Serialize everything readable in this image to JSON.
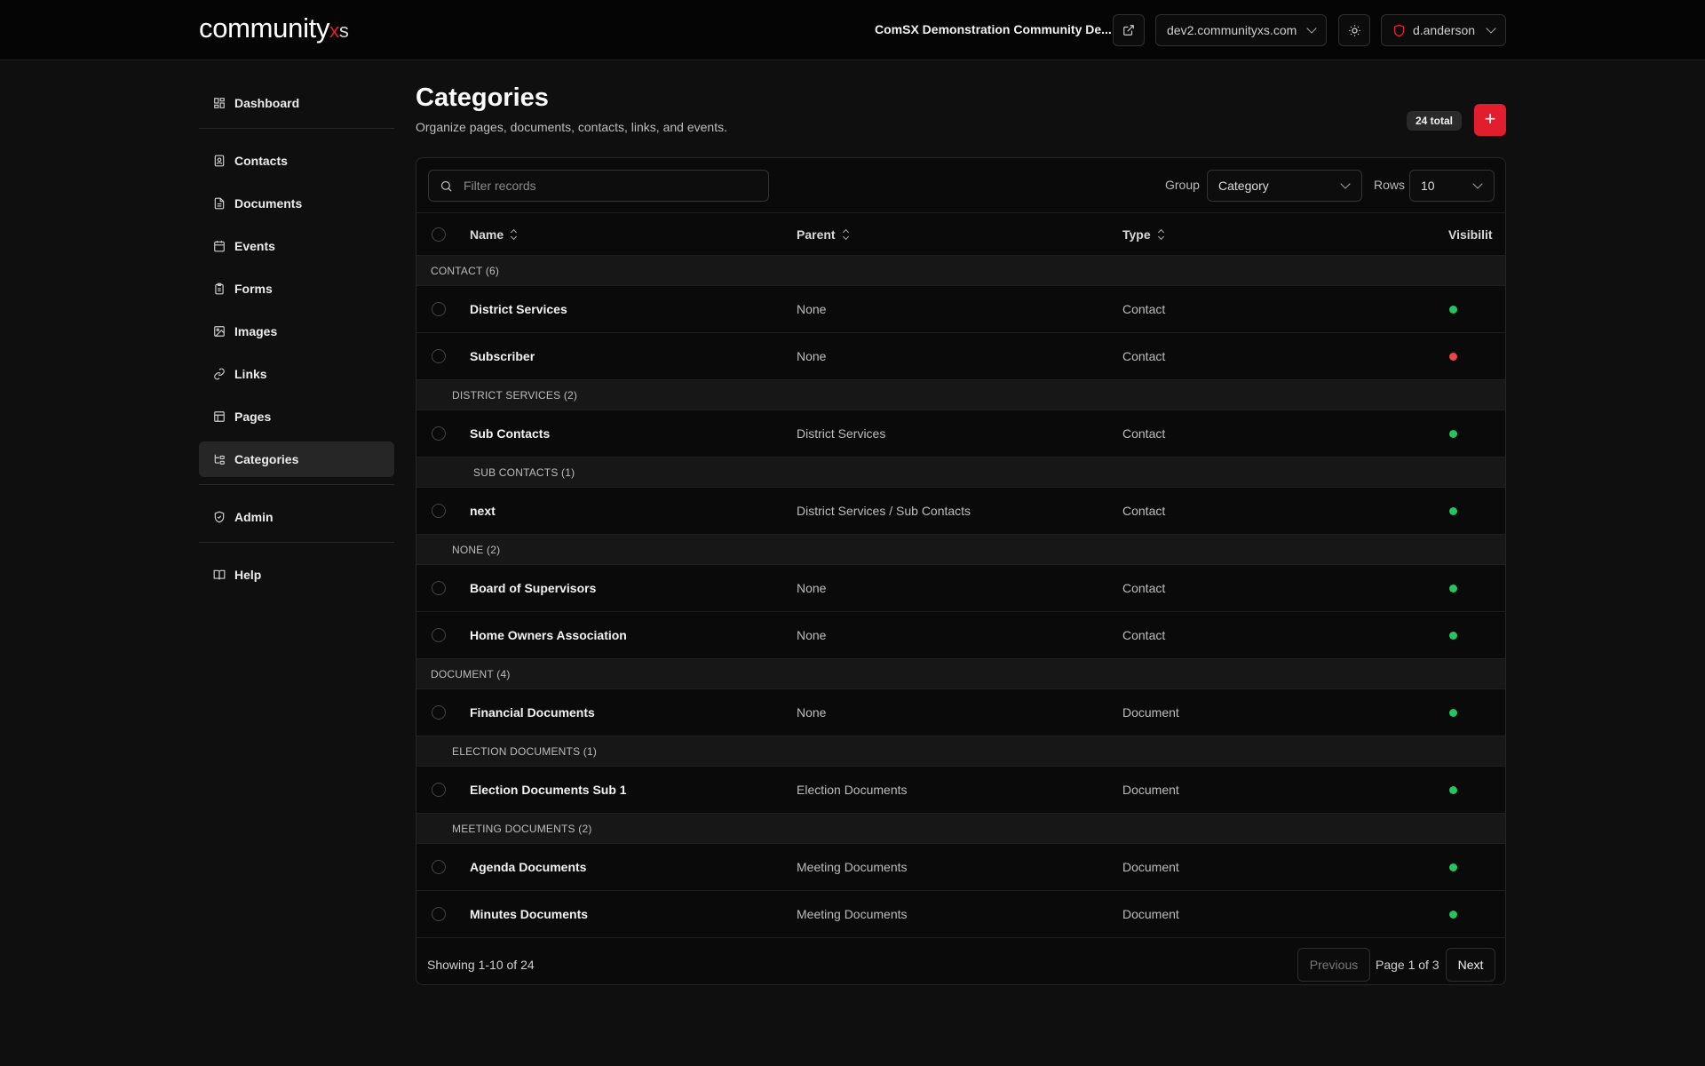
{
  "header": {
    "logo_main": "community",
    "logo_x": "x",
    "logo_s": "s",
    "site_title": "ComSX Demonstration Community De...",
    "domain_select": "dev2.communityxs.com",
    "user": "d.anderson",
    "brand_color": "#e11d2e"
  },
  "sidebar": {
    "items": [
      {
        "label": "Dashboard",
        "icon": "dashboard-icon"
      },
      {
        "label": "Contacts",
        "icon": "contact-icon"
      },
      {
        "label": "Documents",
        "icon": "document-icon"
      },
      {
        "label": "Events",
        "icon": "calendar-icon"
      },
      {
        "label": "Forms",
        "icon": "clipboard-icon"
      },
      {
        "label": "Images",
        "icon": "image-icon"
      },
      {
        "label": "Links",
        "icon": "link-icon"
      },
      {
        "label": "Pages",
        "icon": "layout-icon"
      },
      {
        "label": "Categories",
        "icon": "categories-icon"
      },
      {
        "label": "Admin",
        "icon": "shield-icon"
      },
      {
        "label": "Help",
        "icon": "book-icon"
      }
    ],
    "active": "Categories"
  },
  "page": {
    "title": "Categories",
    "subtitle": "Organize pages, documents, contacts, links, and events.",
    "total": "24 total",
    "add_label": "+"
  },
  "toolbar": {
    "filter_placeholder": "Filter records",
    "group_label": "Group",
    "group_value": "Category",
    "rows_label": "Rows",
    "rows_value": "10"
  },
  "table": {
    "columns": [
      "Name",
      "Parent",
      "Type",
      "Visibilit"
    ],
    "groups": [
      {
        "label": "CONTACT (6)",
        "indent": 0
      },
      {
        "label": "DISTRICT SERVICES (2)",
        "indent": 1
      },
      {
        "label": "SUB CONTACTS (1)",
        "indent": 2
      },
      {
        "label": "NONE (2)",
        "indent": 1
      },
      {
        "label": "DOCUMENT (4)",
        "indent": 0
      },
      {
        "label": "ELECTION DOCUMENTS (1)",
        "indent": 1
      },
      {
        "label": "MEETING DOCUMENTS (2)",
        "indent": 1
      }
    ],
    "rows": [
      {
        "name": "District Services",
        "parent": "None",
        "type": "Contact",
        "visible": true
      },
      {
        "name": "Subscriber",
        "parent": "None",
        "type": "Contact",
        "visible": false
      },
      {
        "name": "Sub Contacts",
        "parent": "District Services",
        "type": "Contact",
        "visible": true
      },
      {
        "name": "next",
        "parent": "District Services / Sub Contacts",
        "type": "Contact",
        "visible": true
      },
      {
        "name": "Board of Supervisors",
        "parent": "None",
        "type": "Contact",
        "visible": true
      },
      {
        "name": "Home Owners Association",
        "parent": "None",
        "type": "Contact",
        "visible": true
      },
      {
        "name": "Financial Documents",
        "parent": "None",
        "type": "Document",
        "visible": true
      },
      {
        "name": "Election Documents Sub 1",
        "parent": "Election Documents",
        "type": "Document",
        "visible": true
      },
      {
        "name": "Agenda Documents",
        "parent": "Meeting Documents",
        "type": "Document",
        "visible": true
      },
      {
        "name": "Minutes Documents",
        "parent": "Meeting Documents",
        "type": "Document",
        "visible": true
      }
    ],
    "visible_color": "#22c55e",
    "hidden_color": "#ef4444"
  },
  "footer": {
    "showing": "Showing 1-10 of 24",
    "previous": "Previous",
    "page_info": "Page 1 of 3",
    "next": "Next"
  }
}
